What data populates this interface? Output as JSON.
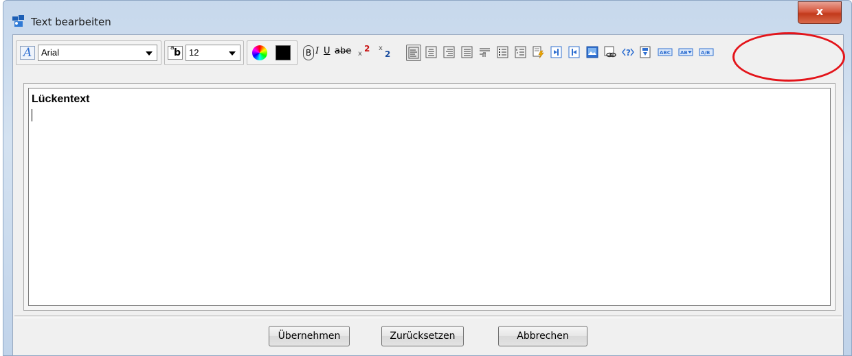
{
  "window": {
    "title": "Text bearbeiten",
    "close_label": "x"
  },
  "toolbar": {
    "font_name": "Arial",
    "font_size": "12",
    "color_swatch": "#000000"
  },
  "editor": {
    "content": "Lückentext"
  },
  "buttons": {
    "apply": "Übernehmen",
    "reset": "Zurücksetzen",
    "cancel": "Abbrechen"
  },
  "colors": {
    "accent": "#2f6fd0",
    "highlight_circle": "#e3141a",
    "close_button": "#c23a1b"
  }
}
